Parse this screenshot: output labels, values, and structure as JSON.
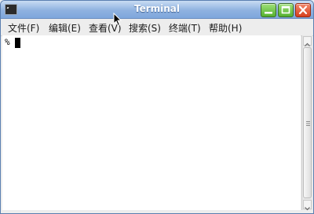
{
  "window": {
    "title": "Terminal",
    "icons": {
      "app": "terminal-icon",
      "minimize": "minimize-icon",
      "maximize": "maximize-icon",
      "close": "close-icon"
    },
    "colors": {
      "titlebar": "#8fb2e0",
      "minimize": "#54b02f",
      "maximize": "#54b02f",
      "close": "#d6401e"
    }
  },
  "menubar": {
    "items": [
      {
        "label": "文件(F)"
      },
      {
        "label": "编辑(E)"
      },
      {
        "label": "查看(V)"
      },
      {
        "label": "搜索(S)"
      },
      {
        "label": "终端(T)"
      },
      {
        "label": "帮助(H)"
      }
    ]
  },
  "terminal": {
    "prompt": "%"
  }
}
